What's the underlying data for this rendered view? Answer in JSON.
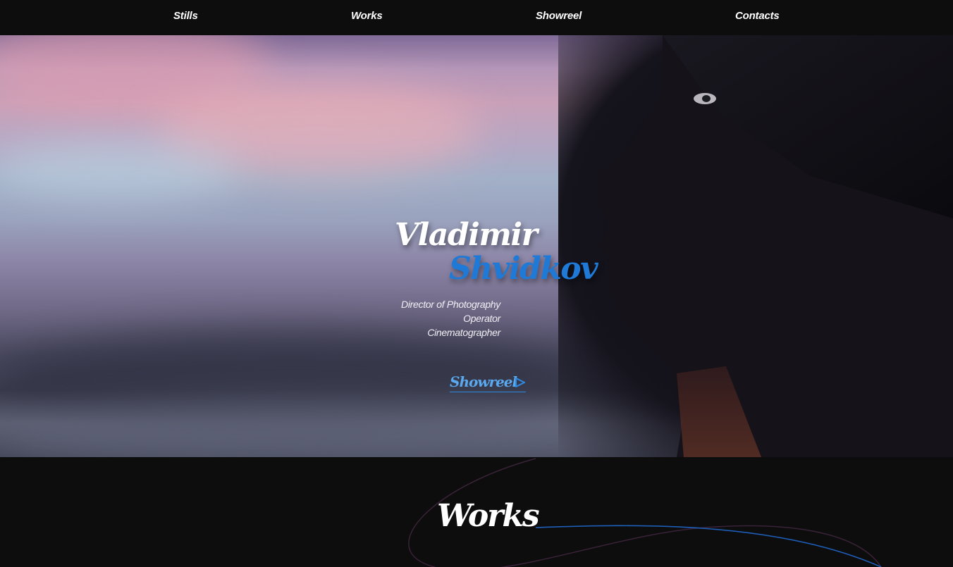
{
  "nav": {
    "items": [
      {
        "label": "Stills"
      },
      {
        "label": "Works"
      },
      {
        "label": "Showreel"
      },
      {
        "label": "Contacts"
      }
    ]
  },
  "hero": {
    "first_name": "Vladimir",
    "last_name": "Shvidkov",
    "roles": [
      "Director of Photography",
      "Operator",
      "Cinematographer"
    ],
    "showreel_label": "Showreel",
    "accent_color": "#1e7ad6"
  },
  "socials": [
    {
      "icon": "telegram-icon"
    },
    {
      "icon": "vk-icon"
    },
    {
      "icon": "instagram-icon"
    }
  ],
  "works": {
    "title": "Works"
  }
}
